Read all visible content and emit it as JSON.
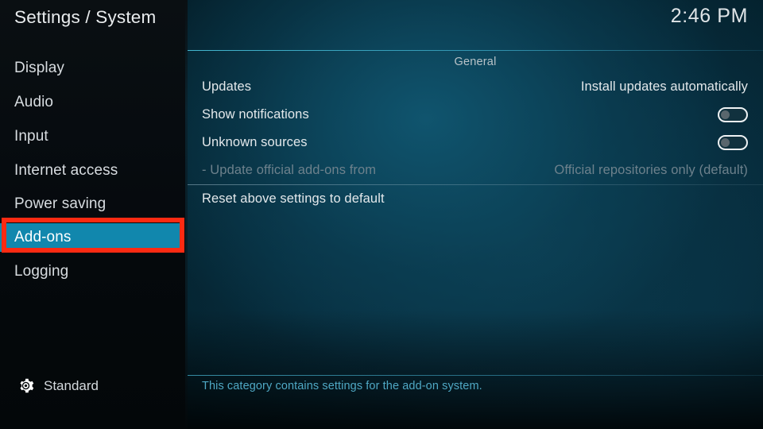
{
  "header": {
    "title": "Settings / System",
    "clock": "2:46 PM"
  },
  "sidebar": {
    "items": [
      {
        "label": "Display",
        "selected": false
      },
      {
        "label": "Audio",
        "selected": false
      },
      {
        "label": "Input",
        "selected": false
      },
      {
        "label": "Internet access",
        "selected": false
      },
      {
        "label": "Power saving",
        "selected": false
      },
      {
        "label": "Add-ons",
        "selected": true
      },
      {
        "label": "Logging",
        "selected": false
      }
    ],
    "settings_level": {
      "icon": "gear-icon",
      "label": "Standard"
    }
  },
  "main": {
    "group_title": "General",
    "rows": [
      {
        "label": "Updates",
        "value": "Install updates automatically",
        "type": "value",
        "disabled": false
      },
      {
        "label": "Show notifications",
        "value": "",
        "type": "toggle",
        "toggle_state": "off",
        "disabled": false
      },
      {
        "label": "Unknown sources",
        "value": "",
        "type": "toggle",
        "toggle_state": "off",
        "disabled": false
      },
      {
        "label": "- Update official add-ons from",
        "value": "Official repositories only (default)",
        "type": "value",
        "disabled": true
      },
      {
        "label": "Reset above settings to default",
        "value": "",
        "type": "action",
        "disabled": false
      }
    ],
    "description": "This category contains settings for the add-on system."
  },
  "annotation": {
    "target": "Add-ons",
    "color": "#fc2a12"
  },
  "colors": {
    "accent_teal": "#1187ad",
    "header_rule": "#46bed7",
    "description_text": "#4fa8c4",
    "disabled_text": "#6d818c",
    "annotation_red": "#fc2a12"
  }
}
